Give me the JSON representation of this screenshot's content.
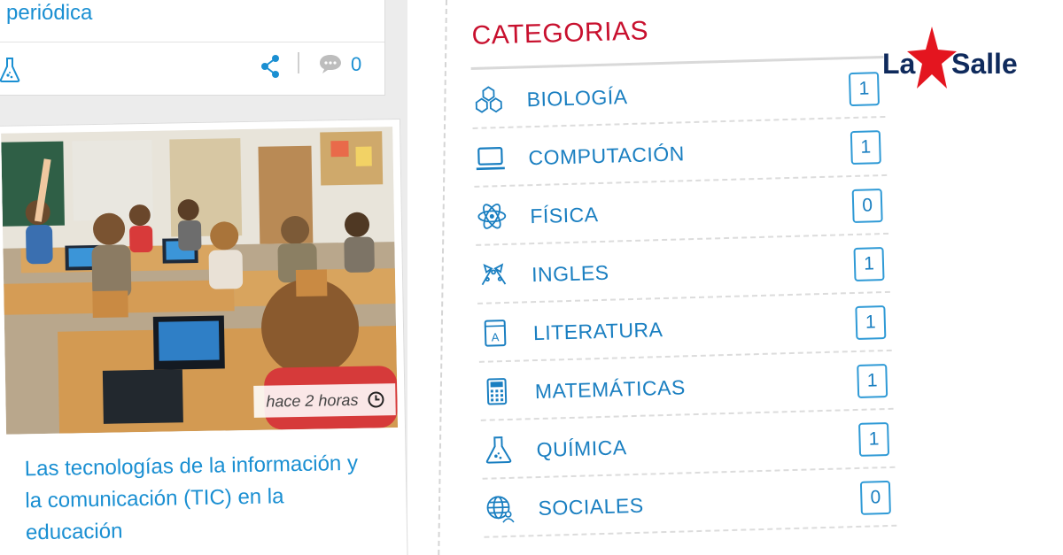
{
  "top_card": {
    "title_fragment": "periódica",
    "category_icon": "flask-icon",
    "share_icon": "share-icon",
    "comment_icon": "comment-icon",
    "comment_count": "0"
  },
  "main_card": {
    "image_alt": "classroom with students using laptops",
    "time_ago": "hace 2 horas",
    "clock_icon": "clock-icon",
    "title": "Las tecnologías de la información y la comunicación (TIC) en la educación"
  },
  "categories": {
    "heading": "CATEGORIAS",
    "items": [
      {
        "label": "BIOLOGÍA",
        "count": "1",
        "icon": "molecule-icon"
      },
      {
        "label": "COMPUTACIÓN",
        "count": "1",
        "icon": "laptop-icon"
      },
      {
        "label": "FÍSICA",
        "count": "0",
        "icon": "atom-icon"
      },
      {
        "label": "INGLES",
        "count": "1",
        "icon": "flags-icon"
      },
      {
        "label": "LITERATURA",
        "count": "1",
        "icon": "book-icon"
      },
      {
        "label": "MATEMÁTICAS",
        "count": "1",
        "icon": "calculator-icon"
      },
      {
        "label": "QUÍMICA",
        "count": "1",
        "icon": "flask-icon"
      },
      {
        "label": "SOCIALES",
        "count": "0",
        "icon": "globe-icon"
      }
    ]
  },
  "logo": {
    "left_text": "La",
    "right_text": "Salle"
  },
  "colors": {
    "accent_blue": "#1a7fc1",
    "heading_red": "#c8102e",
    "logo_navy": "#0f2a5c",
    "logo_star_red": "#e4151f"
  }
}
